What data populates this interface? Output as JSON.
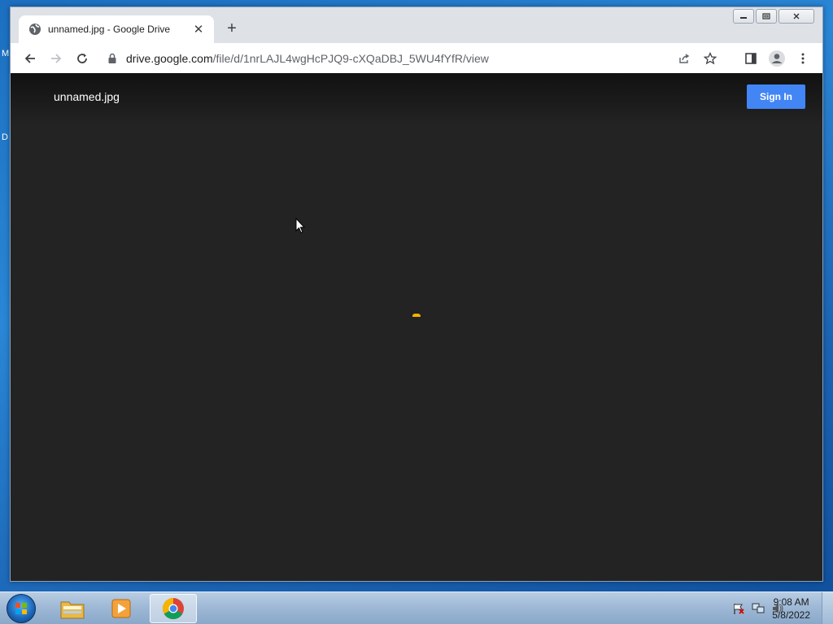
{
  "desktop": {
    "edge_letters": [
      "M",
      "D"
    ]
  },
  "browser": {
    "tab": {
      "title": "unnamed.jpg - Google Drive",
      "close_glyph": "✕"
    },
    "new_tab_glyph": "+",
    "url": {
      "host": "drive.google.com",
      "path": "/file/d/1nrLAJL4wgHcPJQ9-cXQaDBJ_5WU4fYfR/view"
    }
  },
  "viewer": {
    "file_name": "unnamed.jpg",
    "sign_in_label": "Sign In"
  },
  "taskbar": {
    "clock_time": "9:08 AM",
    "clock_date": "5/8/2022"
  },
  "colors": {
    "accent": "#4285f4",
    "viewer_bg": "#232323",
    "spinner": "#f4b400"
  }
}
